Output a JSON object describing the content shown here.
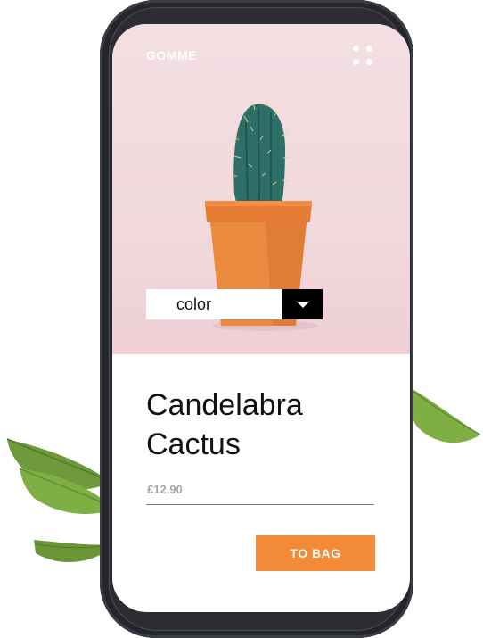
{
  "app": {
    "brand": "GOMME"
  },
  "product": {
    "name_line1": "Candelabra",
    "name_line2": "Cactus",
    "price": "£12.90"
  },
  "color_select": {
    "label": "color"
  },
  "actions": {
    "to_bag": "TO BAG"
  },
  "icons": {
    "menu": "grid-menu-icon",
    "dropdown": "caret-down-icon"
  },
  "colors": {
    "accent": "#f38a38",
    "hero_background": "#f1d9dd",
    "phone_frame": "#2b2d33"
  }
}
